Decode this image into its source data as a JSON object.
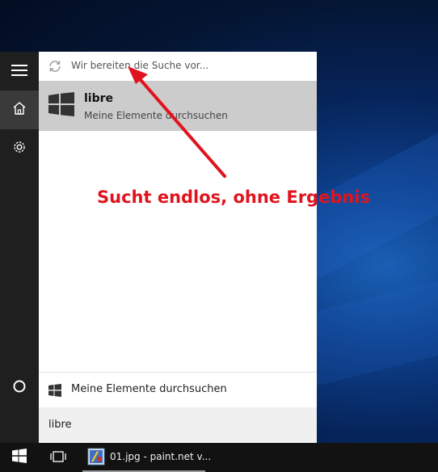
{
  "search": {
    "status_text": "Wir bereiten die Suche vor...",
    "query": "libre"
  },
  "best_match": {
    "title": "libre",
    "subtitle": "Meine Elemente durchsuchen"
  },
  "bottom_action": {
    "label": "Meine Elemente durchsuchen"
  },
  "annotation": {
    "text": "Sucht endlos, ohne Ergebnis",
    "color": "#e0141e"
  },
  "taskbar": {
    "app_label": "01.jpg - paint.net v..."
  },
  "icons": {
    "menu": "hamburger-icon",
    "home": "home-icon",
    "settings": "gear-icon",
    "cortana": "cortana-circle-icon",
    "spinner": "refresh-spinner-icon",
    "result": "windows-logo-icon",
    "start": "windows-start-icon",
    "task_view": "task-view-icon",
    "app": "paint-net-icon"
  },
  "colors": {
    "rail": "#1f1f1f",
    "rail_active": "#3a3a3a",
    "result_highlight": "#cccccc",
    "taskbar": "#121212"
  }
}
